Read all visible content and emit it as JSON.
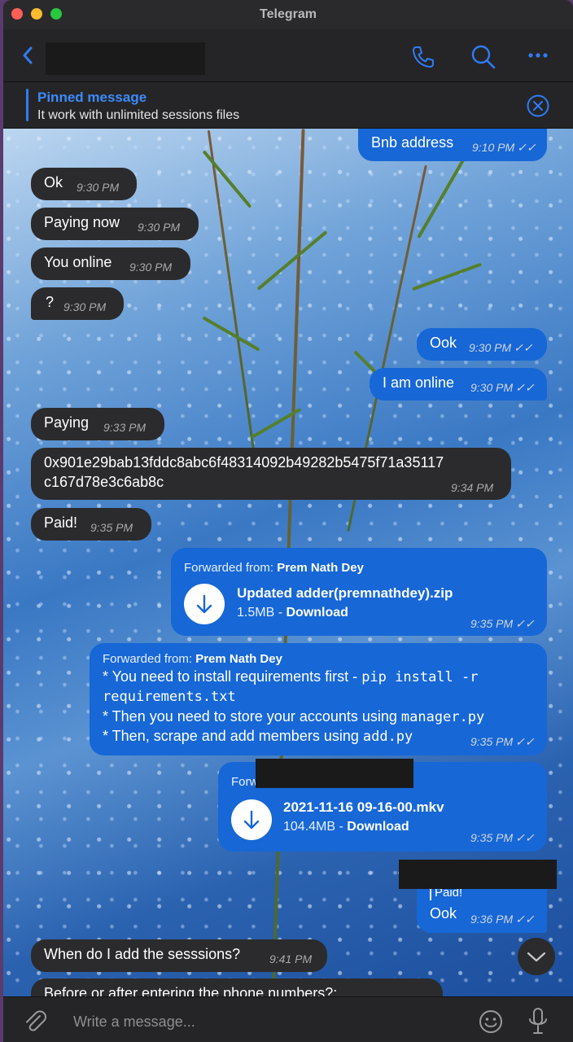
{
  "window": {
    "title": "Telegram"
  },
  "pinned": {
    "title": "Pinned message",
    "text": "It work with unlimited sessions files"
  },
  "messages": [
    {
      "text": "Bnb address",
      "time": "9:10 PM"
    },
    {
      "text": "Ok",
      "time": "9:30 PM"
    },
    {
      "text": "Paying now",
      "time": "9:30 PM"
    },
    {
      "text": "You online",
      "time": "9:30 PM"
    },
    {
      "text": "?",
      "time": "9:30 PM"
    },
    {
      "text": "Ook",
      "time": "9:30 PM"
    },
    {
      "text": "I am online",
      "time": "9:30 PM"
    },
    {
      "text": "Paying",
      "time": "9:33 PM"
    },
    {
      "text_line1": "0x901e29bab13fddc8abc6f48314092b49282b5475f71a35117",
      "text_line2": "c167d78e3c6ab8c",
      "time": "9:34 PM"
    },
    {
      "text": "Paid!",
      "time": "9:35 PM"
    },
    {
      "forward_label": "Forwarded from:",
      "forward_name": "Prem Nath Dey",
      "file_name": "Updated adder(premnathdey).zip",
      "file_size": "1.5MB - ",
      "download": "Download",
      "time": "9:35 PM"
    },
    {
      "forward_label": "Forwarded from:",
      "forward_name": "Prem Nath Dey",
      "l1_text": "* You need to install requirements first - ",
      "l1_code": "pip install -r",
      "l2_code": "requirements.txt",
      "l3_text": "* Then you need to store your accounts using ",
      "l3_code": "manager.py",
      "l4_text": "* Then, scrape and add members using ",
      "l4_code": "add.py",
      "time": "9:35 PM"
    },
    {
      "forward_label": "Forw",
      "file_name": "2021-11-16 09-16-00.mkv",
      "file_size": "104.4MB - ",
      "download": "Download",
      "time": "9:35 PM"
    },
    {
      "reply_text": "Paid!",
      "text": "Ook",
      "time": "9:36 PM"
    },
    {
      "text": "When do I add the sesssions?",
      "time": "9:41 PM"
    },
    {
      "text": "Before or after entering the phone numbers?:"
    }
  ],
  "composer": {
    "placeholder": "Write a message..."
  },
  "colors": {
    "accent": "#1767d6",
    "link": "#3d8bfd",
    "incoming": "#2b2b2d"
  },
  "icons": [
    "back-icon",
    "phone-icon",
    "search-icon",
    "more-icon",
    "close-circle-icon",
    "download-icon",
    "attach-icon",
    "emoji-icon",
    "mic-icon",
    "chevron-down-icon",
    "double-check-icon"
  ]
}
